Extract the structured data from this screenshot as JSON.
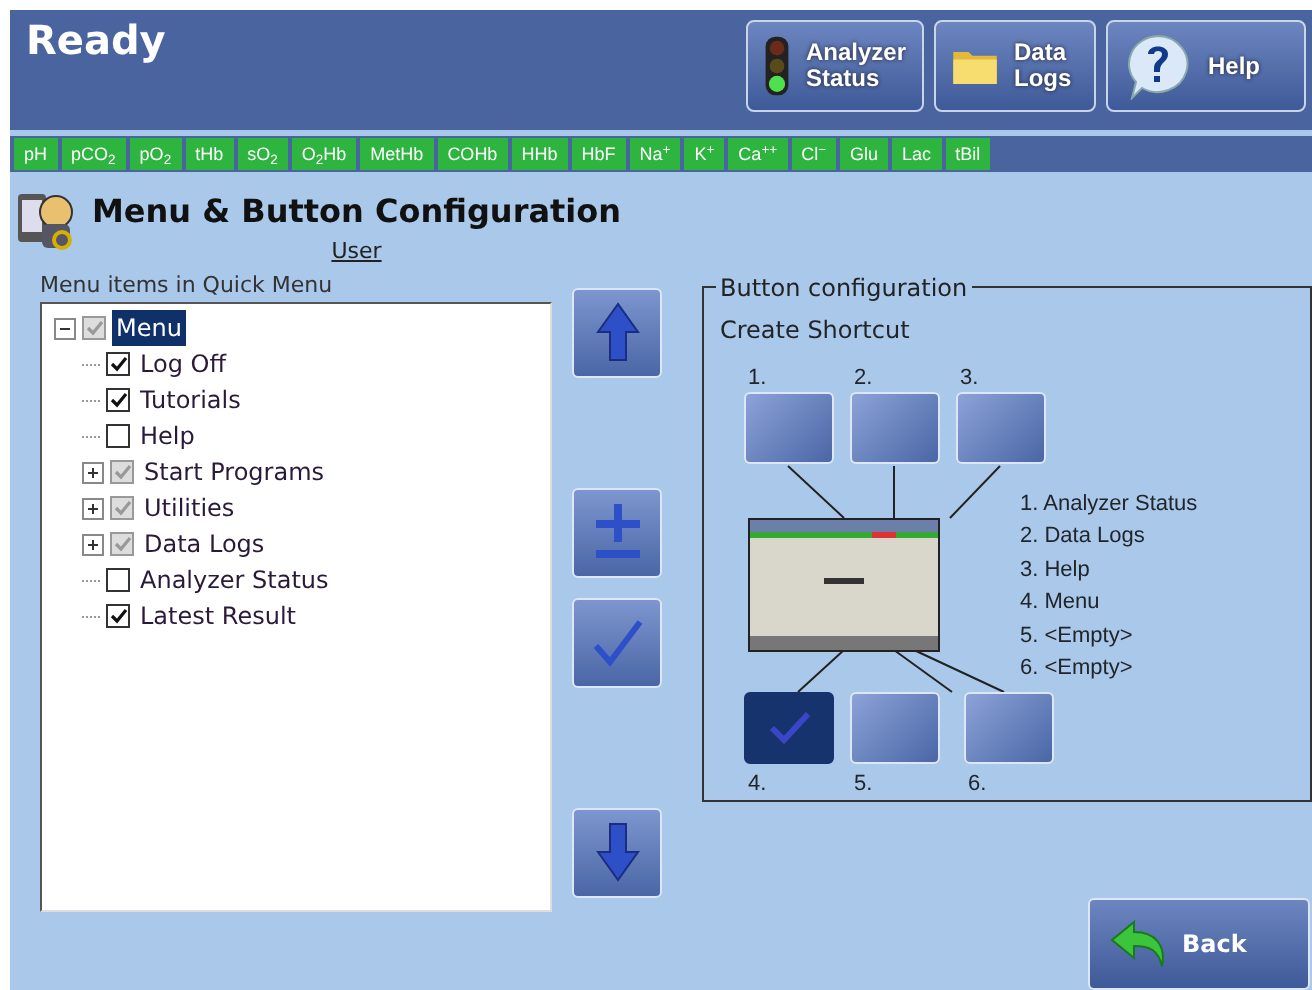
{
  "header": {
    "status": "Ready",
    "buttons": [
      {
        "kind": "status",
        "label": "Analyzer Status"
      },
      {
        "kind": "folder",
        "label": "Data Logs"
      },
      {
        "kind": "help",
        "label": "Help"
      }
    ]
  },
  "parameters": [
    "pH",
    "pCO$_{2}$",
    "pO$_{2}$",
    "tHb",
    "sO$_{2}$",
    "O$_{2}$Hb",
    "MetHb",
    "COHb",
    "HHb",
    "HbF",
    "Na$^{+}$",
    "K$^{+}$",
    "Ca$^{++}$",
    "Cl$^{−}$",
    "Glu",
    "Lac",
    "tBil"
  ],
  "page": {
    "title": "Menu & Button Configuration",
    "user": "User"
  },
  "tree": {
    "label": "Menu items in Quick Menu",
    "items": [
      {
        "label": "Menu",
        "checked": true,
        "disabled": true,
        "selected": true,
        "expanded": true,
        "children": [
          {
            "label": "Log Off",
            "checked": true,
            "disabled": false,
            "selected": false
          },
          {
            "label": "Tutorials",
            "checked": true,
            "disabled": false,
            "selected": false
          },
          {
            "label": "Help",
            "checked": false,
            "disabled": false,
            "selected": false
          },
          {
            "label": "Start Programs",
            "checked": true,
            "disabled": true,
            "selected": false,
            "expanded": false
          },
          {
            "label": "Utilities",
            "checked": true,
            "disabled": true,
            "selected": false,
            "expanded": false
          },
          {
            "label": "Data Logs",
            "checked": true,
            "disabled": true,
            "selected": false,
            "expanded": false
          },
          {
            "label": "Analyzer Status",
            "checked": false,
            "disabled": false,
            "selected": false
          },
          {
            "label": "Latest Result",
            "checked": true,
            "disabled": false,
            "selected": false
          }
        ]
      }
    ]
  },
  "tools": [
    {
      "kind": "up"
    },
    {
      "kind": "plusminus"
    },
    {
      "kind": "check"
    },
    {
      "kind": "down"
    }
  ],
  "button_config": {
    "legend": "Button configuration",
    "heading": "Create Shortcut",
    "slots": [
      {
        "number": "1.",
        "selected": false
      },
      {
        "number": "2.",
        "selected": false
      },
      {
        "number": "3.",
        "selected": false
      },
      {
        "number": "4.",
        "selected": true
      },
      {
        "number": "5.",
        "selected": false
      },
      {
        "number": "6.",
        "selected": false
      }
    ],
    "assignments": [
      "1. Analyzer Status",
      "2. Data Logs",
      "3. Help",
      "4. Menu",
      "5. <Empty>",
      "6. <Empty>"
    ]
  },
  "back": {
    "label": "Back"
  }
}
